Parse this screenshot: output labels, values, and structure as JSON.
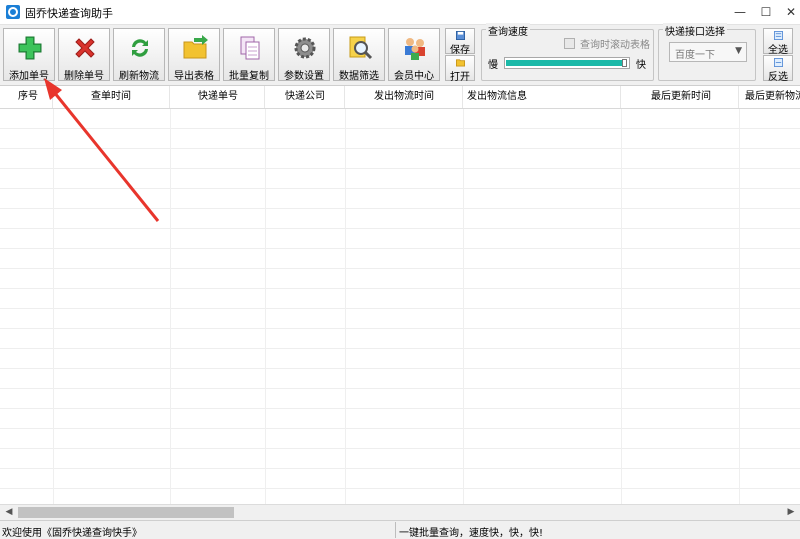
{
  "window": {
    "title": "固乔快递查询助手"
  },
  "window_controls": {
    "minimize": "—",
    "maximize": "☐",
    "close": "✕"
  },
  "toolbar": {
    "buttons": [
      {
        "label": "添加单号",
        "icon": "green-plus-icon"
      },
      {
        "label": "删除单号",
        "icon": "red-x-icon"
      },
      {
        "label": "刷新物流",
        "icon": "refresh-icon"
      },
      {
        "label": "导出表格",
        "icon": "folder-export-icon"
      },
      {
        "label": "批量复制",
        "icon": "copy-documents-icon"
      },
      {
        "label": "参数设置",
        "icon": "gear-icon"
      },
      {
        "label": "数据筛选",
        "icon": "search-filter-icon"
      },
      {
        "label": "会员中心",
        "icon": "members-icon"
      }
    ],
    "save_label": "保存",
    "open_label": "打开",
    "speed_group": {
      "title": "查询速度",
      "checkbox_label": "查询时滚动表格",
      "slow_label": "慢",
      "fast_label": "快",
      "speed_level": 1.0
    },
    "api_group": {
      "title": "快递接口选择",
      "selected": "百度一下"
    },
    "select_all_label": "全选",
    "invert_label": "反选"
  },
  "table": {
    "columns": [
      "序号",
      "查单时间",
      "快递单号",
      "快递公司",
      "发出物流时间",
      "发出物流信息",
      "最后更新时间",
      "最后更新物流"
    ],
    "rows": []
  },
  "status": {
    "left": "欢迎使用《固乔快递查询快手》",
    "right": "一键批量查询，速度快，快，快!"
  },
  "colors": {
    "accent": "#1bb9a8",
    "arrow": "#e8352c"
  }
}
